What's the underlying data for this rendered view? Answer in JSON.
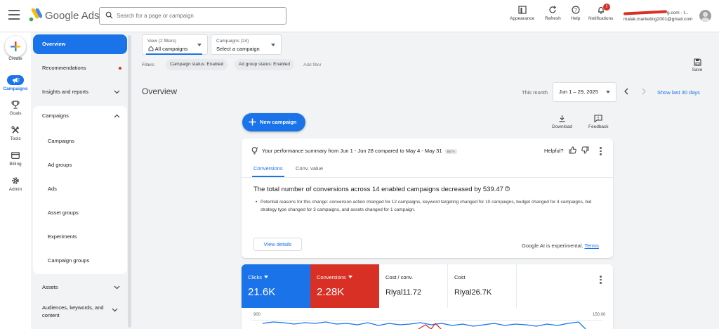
{
  "header": {
    "brand": "Google Ads",
    "search_placeholder": "Search for a page or campaign",
    "buttons": {
      "appearance": "Appearance",
      "refresh": "Refresh",
      "help": "Help",
      "notifications": "Notifications"
    },
    "notification_count": "!",
    "account_domain_tail": "g.com - t...",
    "account_email": "malak.marketing2001@gmail.com"
  },
  "rail": {
    "create": "Create",
    "campaigns": "Campaigns",
    "goals": "Goals",
    "tools": "Tools",
    "billing": "Billing",
    "admin": "Admin"
  },
  "sidebar": {
    "overview": "Overview",
    "recommendations": "Recommendations",
    "insights": "Insights and reports",
    "campaigns_header": "Campaigns",
    "sub_items": [
      "Campaigns",
      "Ad groups",
      "Ads",
      "Asset groups",
      "Experiments",
      "Campaign groups"
    ],
    "assets": "Assets",
    "audiences": "Audiences, keywords, and content"
  },
  "toolbar": {
    "view_small": "View (2 filters)",
    "view_big": "All campaigns",
    "campaigns_small": "Campaigns (24)",
    "campaigns_big": "Select a campaign",
    "filters_label": "Filters",
    "chips": [
      "Campaign status: Enabled",
      "Ad group status: Enabled"
    ],
    "add_filter": "Add filter",
    "save": "Save"
  },
  "page": {
    "title": "Overview",
    "this_month": "This month",
    "date_range": "Jun 1 – 29, 2025",
    "show_last": "Show last 30 days",
    "new_campaign": "New campaign",
    "download": "Download",
    "feedback": "Feedback"
  },
  "summary": {
    "headline": "Your performance summary from Jun 1 - Jun 28 compared to May 4 - May 31",
    "beta": "BETA",
    "helpful": "Helpful?",
    "tabs": [
      "Conversions",
      "Conv. value"
    ],
    "main": "The total number of conversions across 14 enabled campaigns decreased by 539.47",
    "detail": "Potential reasons for this change: conversion action changed for 12 campaigns, keyword targeting changed for 10 campaigns, budget changed for 4 campaigns, bid strategy type changed for 3 campaigns, and assets changed for 1 campaign.",
    "view_details": "View details",
    "ai_note": "Google AI is experimental.",
    "terms": "Terms"
  },
  "metrics": [
    {
      "label": "Clicks",
      "value": "21.6K",
      "color": "#1a73e8"
    },
    {
      "label": "Conversions",
      "value": "2.28K",
      "color": "#d93025"
    },
    {
      "label": "Cost / conv.",
      "value": "Riyal11.72"
    },
    {
      "label": "Cost",
      "value": "Riyal26.7K"
    }
  ],
  "chart": {
    "left_axis_top": "900",
    "right_axis_top": "150.00"
  },
  "colors": {
    "accent": "#1a73e8",
    "alert": "#d93025"
  }
}
